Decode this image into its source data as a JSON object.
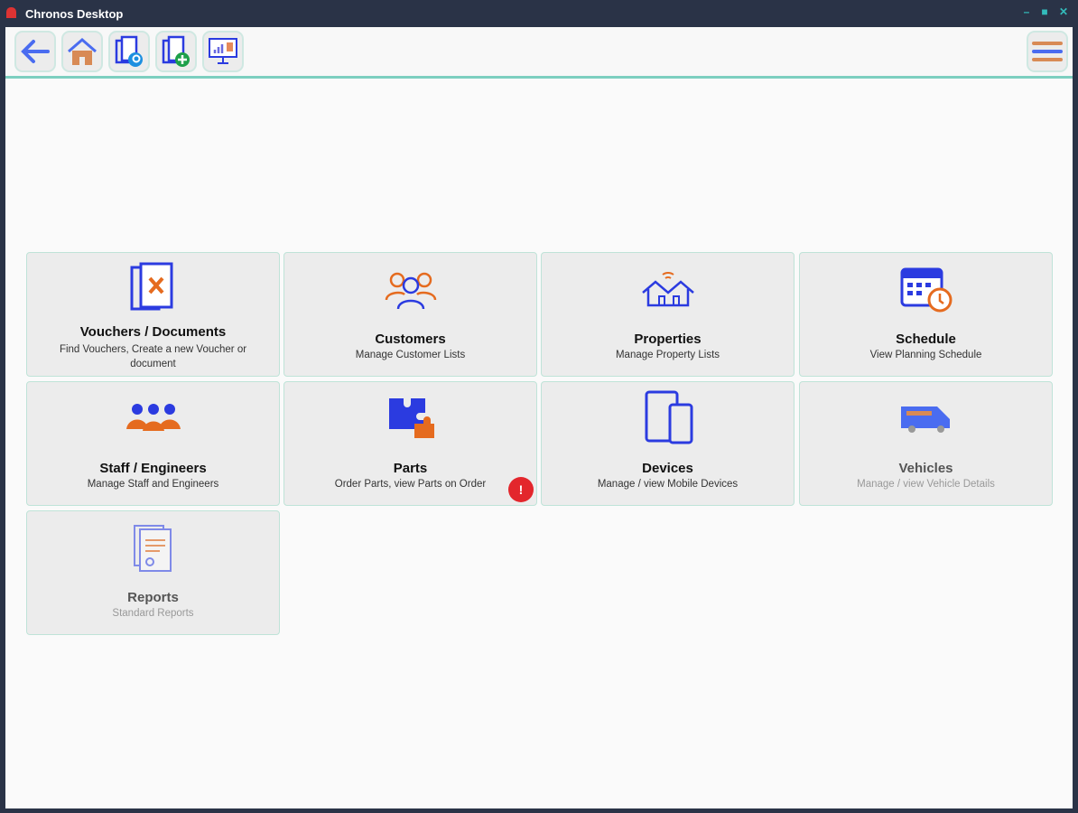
{
  "window": {
    "title": "Chronos Desktop"
  },
  "toolbar": {
    "buttons": [
      "back-icon",
      "home-icon",
      "find-document-icon",
      "new-document-icon",
      "dashboard-icon"
    ],
    "menu": "hamburger-menu-icon"
  },
  "tiles": [
    {
      "title": "Vouchers / Documents",
      "subtitle": "Find Vouchers, Create a new Voucher or document",
      "icon": "documents-tools-icon"
    },
    {
      "title": "Customers",
      "subtitle": "Manage Customer Lists",
      "icon": "customers-icon"
    },
    {
      "title": "Properties",
      "subtitle": "Manage Property Lists",
      "icon": "houses-icon"
    },
    {
      "title": "Schedule",
      "subtitle": "View Planning Schedule",
      "icon": "calendar-clock-icon"
    },
    {
      "title": "Staff / Engineers",
      "subtitle": "Manage Staff and Engineers",
      "icon": "staff-group-icon"
    },
    {
      "title": "Parts",
      "subtitle": "Order Parts, view Parts on Order",
      "icon": "puzzle-icon",
      "badge": "!"
    },
    {
      "title": "Devices",
      "subtitle": "Manage / view Mobile Devices",
      "icon": "devices-icon"
    },
    {
      "title": "Vehicles",
      "subtitle": "Manage / view Vehicle Details",
      "icon": "van-icon"
    },
    {
      "title": "Reports",
      "subtitle": "Standard Reports",
      "icon": "report-icon"
    }
  ]
}
